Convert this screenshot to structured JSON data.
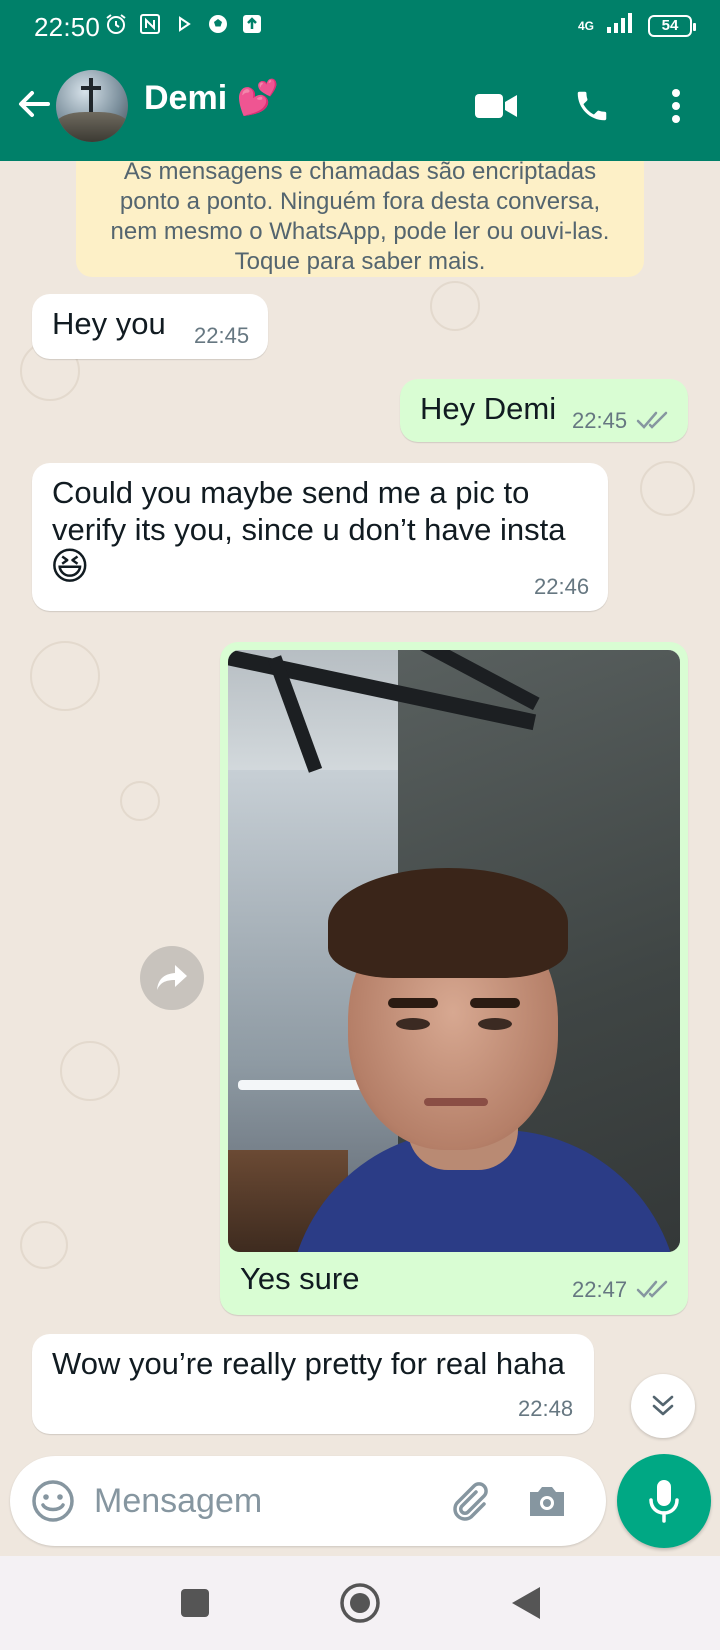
{
  "status_bar": {
    "time": "22:50",
    "network": "4G",
    "battery": "54"
  },
  "header": {
    "contact_name": "Demi 💕"
  },
  "notice": {
    "text": "As mensagens e chamadas são encriptadas ponto a ponto. Ninguém fora desta conversa, nem mesmo o WhatsApp, pode ler ou ouvi-las. Toque para saber mais."
  },
  "messages": [
    {
      "direction": "in",
      "text": "Hey you",
      "time": "22:45"
    },
    {
      "direction": "out",
      "text": "Hey Demi",
      "time": "22:45",
      "status": "read"
    },
    {
      "direction": "in",
      "text": "Could you maybe send me a pic to verify its you, since u don’t have insta",
      "emoji": "😆",
      "time": "22:46"
    },
    {
      "direction": "out",
      "type": "image",
      "caption": "Yes sure",
      "time": "22:47",
      "status": "read"
    },
    {
      "direction": "in",
      "text": "Wow you’re really pretty for real haha",
      "time": "22:48"
    }
  ],
  "composer": {
    "placeholder": "Mensagem"
  },
  "colors": {
    "header": "#008069",
    "outgoing_bubble": "#d9fdd3",
    "incoming_bubble": "#ffffff",
    "notice": "#fdf0c7",
    "mic_button": "#00a884",
    "read_ticks": "#8696a0"
  },
  "icons": [
    "back-arrow",
    "video-call",
    "voice-call",
    "more-vert",
    "forward",
    "double-chevron-down",
    "emoji",
    "attach",
    "camera",
    "mic",
    "nav-square",
    "nav-circle",
    "nav-triangle"
  ]
}
